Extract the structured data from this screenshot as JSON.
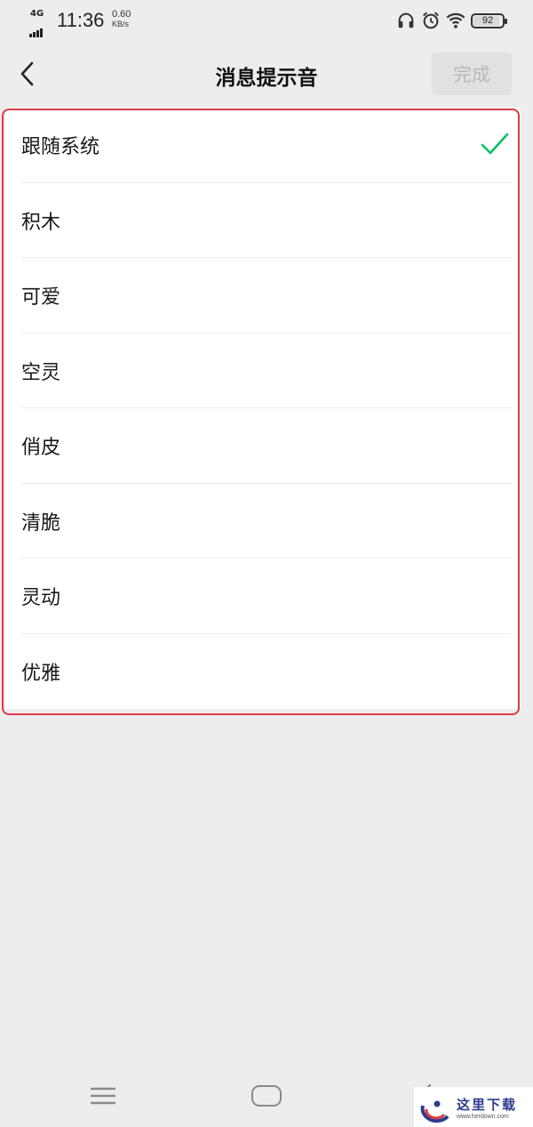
{
  "status_bar": {
    "network": "4G",
    "time": "11:36",
    "speed_value": "0.60",
    "speed_unit": "KB/s",
    "icons": [
      "headphones-icon",
      "alarm-icon",
      "wifi-icon"
    ],
    "battery": "92",
    "battery_level": 0.92
  },
  "nav": {
    "back_icon": "chevron-left-icon",
    "title": "消息提示音",
    "done_label": "完成"
  },
  "sounds": [
    {
      "label": "跟随系统",
      "selected": true
    },
    {
      "label": "积木",
      "selected": false
    },
    {
      "label": "可爱",
      "selected": false
    },
    {
      "label": "空灵",
      "selected": false
    },
    {
      "label": "俏皮",
      "selected": false
    },
    {
      "label": "清脆",
      "selected": false
    },
    {
      "label": "灵动",
      "selected": false
    },
    {
      "label": "优雅",
      "selected": false
    }
  ],
  "system_nav": {
    "icons": [
      "menu-icon",
      "home-icon",
      "back-icon"
    ]
  },
  "watermark": {
    "title": "这里下载",
    "url": "www.herdown.com"
  },
  "colors": {
    "accent": "#07c160",
    "highlight": "#e03a45",
    "background": "#ededed",
    "done_bg": "#e1e1e1",
    "done_text": "#b9b9b9"
  }
}
